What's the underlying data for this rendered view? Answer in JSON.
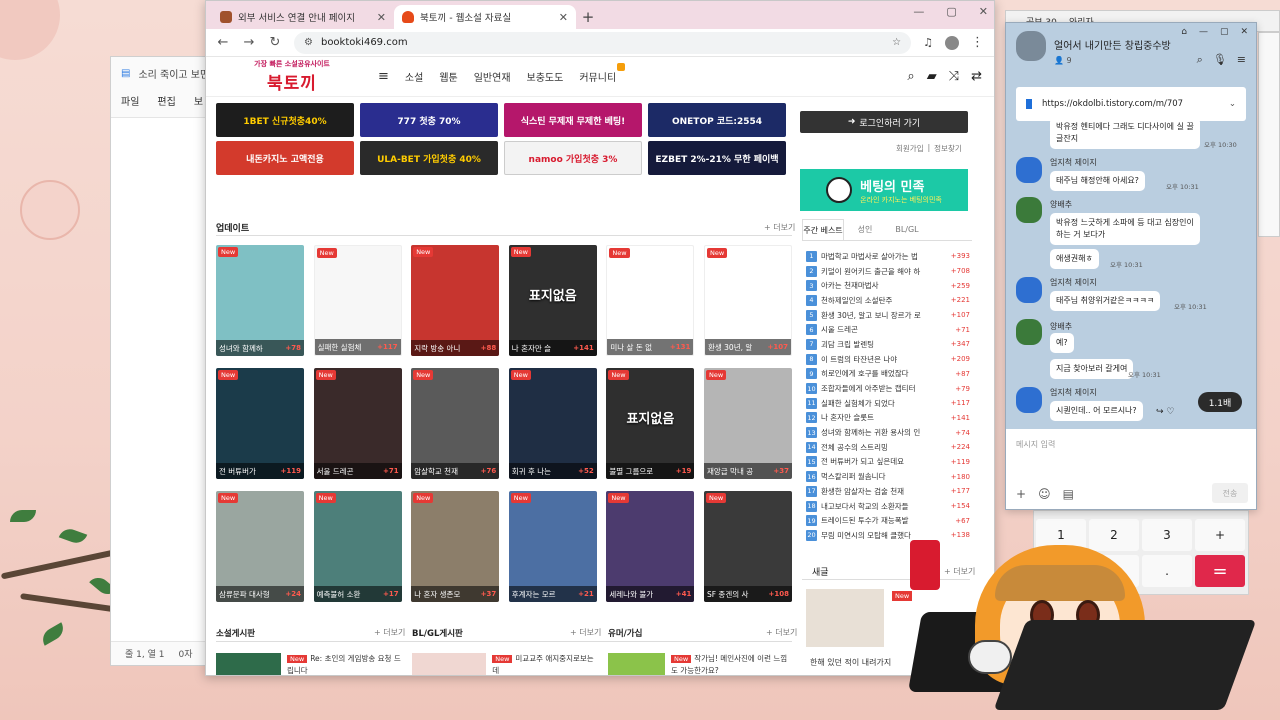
{
  "notepad": {
    "title": "소리 죽이고 보면",
    "menu": [
      "파일",
      "편집",
      "보"
    ],
    "status": [
      "줄 1, 열 1",
      "0자"
    ]
  },
  "browser": {
    "tabs": [
      {
        "title": "외부 서비스 연결 안내 페이지",
        "active": false
      },
      {
        "title": "북토끼 - 웹소설 자료실",
        "active": true
      }
    ],
    "url": "booktoki469.com"
  },
  "site": {
    "logo_tag": "가장 빠른 소설공유사이트",
    "logo_name": "북토끼",
    "nav": [
      "소설",
      "웹툰",
      "일반연재",
      "보충도도",
      "커뮤니티"
    ],
    "banners": [
      {
        "text": "1BET 신규첫충40%",
        "color": "#1d1d1d"
      },
      {
        "text": "777 첫충 70%",
        "color": "#2a2d8f"
      },
      {
        "text": "식스틴 무제재 무제한 베팅!",
        "color": "#b5176b"
      },
      {
        "text": "ONETOP 코드:2554",
        "color": "#1c2a66"
      },
      {
        "text": "내돈카지노 고액전용",
        "color": "#d33a2c"
      },
      {
        "text": "ULA-BET 가입첫충 40%",
        "color": "#2a2a2a"
      },
      {
        "text": "namoo 가입첫충 3%",
        "color": "#e7e7e7"
      },
      {
        "text": "EZBET 2%-21% 무한 페이백",
        "color": "#151a3b"
      }
    ],
    "update_title": "업데이트",
    "more": "+ 더보기",
    "new_label": "New",
    "cards": [
      {
        "title": "성녀와 함께하",
        "count": "+78",
        "bg": "#7fc0c4"
      },
      {
        "title": "실패한 실험체",
        "count": "+117",
        "bg": "#f7f7f7"
      },
      {
        "title": "지락 방송 아니",
        "count": "+88",
        "bg": "#c7352f"
      },
      {
        "title": "나 혼자만 슬",
        "count": "+141",
        "bg": "#2f2f2f",
        "wm": "표지없음"
      },
      {
        "title": "미나 살 돈 없",
        "count": "+131",
        "bg": "#ffffff"
      },
      {
        "title": "환생 30년, 알",
        "count": "+107",
        "bg": "#ffffff"
      },
      {
        "title": "전 버튜버가",
        "count": "+119",
        "bg": "#1b3b4a"
      },
      {
        "title": "서울 드레곤",
        "count": "+71",
        "bg": "#3a2a2a"
      },
      {
        "title": "암살학교 천재",
        "count": "+76",
        "bg": "#5a5a5a"
      },
      {
        "title": "회귀 후 나는",
        "count": "+52",
        "bg": "#1f2e44"
      },
      {
        "title": "불멸 그룹으로",
        "count": "+19",
        "bg": "#2f2f2f",
        "wm": "표지없음"
      },
      {
        "title": "재앙급 막내 공",
        "count": "+37",
        "bg": "#b5b5b5"
      },
      {
        "title": "삼류문파 대사형",
        "count": "+24",
        "bg": "#9aa6a0"
      },
      {
        "title": "예측불허 소환",
        "count": "+17",
        "bg": "#4d7f7a"
      },
      {
        "title": "나 혼자 생존모",
        "count": "+37",
        "bg": "#8c7e6a"
      },
      {
        "title": "후계자는 모르",
        "count": "+21",
        "bg": "#4c6fa3"
      },
      {
        "title": "세레나와 불가",
        "count": "+41",
        "bg": "#4c3b6e"
      },
      {
        "title": "SF 종겐의 사",
        "count": "+108",
        "bg": "#3a3a3a"
      }
    ],
    "sidebar": {
      "login": "로그인하러 가기",
      "links": [
        "회원가입",
        "정보찾기"
      ],
      "betting_title": "베팅의 민족",
      "betting_sub": "온라인 카지노는 베팅의민족",
      "rank_tabs": [
        "주간 베스트",
        "성인",
        "BL/GL"
      ],
      "ranks": [
        {
          "title": "마법학교 마법사로 살아가는 법",
          "count": "+393"
        },
        {
          "title": "키덜이 원어키드 출근을 해야 하",
          "count": "+708"
        },
        {
          "title": "아카는 천재마법사",
          "count": "+259"
        },
        {
          "title": "천하제일인의 소설탄주",
          "count": "+221"
        },
        {
          "title": "환생 30년, 알고 보니 장르가 로",
          "count": "+107"
        },
        {
          "title": "시울 드레곤",
          "count": "+71"
        },
        {
          "title": "괴담 크립 발렌팅",
          "count": "+347"
        },
        {
          "title": "이 트럼의 타잔년은 나야",
          "count": "+209"
        },
        {
          "title": "히로인에게 호구를 배었잖다",
          "count": "+87"
        },
        {
          "title": "조합자들에게 아주받는 캡티터",
          "count": "+79"
        },
        {
          "title": "실패한 실험체가 되었다",
          "count": "+117"
        },
        {
          "title": "나 혼자만 슬롯트",
          "count": "+141"
        },
        {
          "title": "성녀와 함께하는 귀환 용사의 인",
          "count": "+74"
        },
        {
          "title": "전체 공수의 스트리밍",
          "count": "+224"
        },
        {
          "title": "전 버튜버가 되고 싶은데요",
          "count": "+119"
        },
        {
          "title": "먹스칼리퍼 월솜니다",
          "count": "+180"
        },
        {
          "title": "환생한 암살자는 검술 천재",
          "count": "+177"
        },
        {
          "title": "내고보다서 학교의 소환자들",
          "count": "+154"
        },
        {
          "title": "트레이드된 투수가 재능폭발",
          "count": "+67"
        },
        {
          "title": "무림 미연시의 모탑해 클했다",
          "count": "+138"
        }
      ],
      "notice_title": "새글",
      "notice_text": "한해 있던 적이 내려가지"
    },
    "boards": [
      {
        "title": "소설게시판",
        "post": "Re: 초인의 게임방송 요청 드립니다",
        "thumb": "#2e6b4a"
      },
      {
        "title": "BL/GL게시판",
        "post": "미교교주 애지중지로보는데",
        "thumb": "#f0d7d2"
      },
      {
        "title": "유머/가십",
        "post": "작가님! 메인사진에 이런 느낌도 가능한가요?",
        "thumb": "#8bc34a"
      }
    ]
  },
  "desktop_behind": {
    "tabs": [
      "곰보 30",
      "와리자"
    ]
  },
  "calculator": {
    "keys": [
      "1",
      "2",
      "3",
      "+",
      "0",
      ".",
      "="
    ]
  },
  "chat": {
    "room": "얼어서 내기만든 창립중수방",
    "members": "9",
    "url": "https://okdolbi.tistory.com/m/707",
    "messages": [
      {
        "name": "",
        "text": "박유정 헨티에다 그래도 디다사이에 실 끌 글잔지",
        "time": "오후 10:30",
        "avatar": "#ffffff"
      },
      {
        "name": "엄지척 제이지",
        "text": "태주님 해정안해 아세요?",
        "time": "오후 10:31",
        "avatar": "#2e6fd1"
      },
      {
        "name": "양배추",
        "text": "박유정 느긋하게 소파에 등 대고 심장인이 하는 거 보다가",
        "time": "",
        "avatar": "#3b7a3a"
      },
      {
        "name": "",
        "text": "애생권해ㅎ",
        "time": "오후 10:31",
        "avatar": ""
      },
      {
        "name": "엄지척 제이지",
        "text": "태주님 취양위거같은ㅋㅋㅋㅋ",
        "time": "오후 10:31",
        "avatar": "#2e6fd1"
      },
      {
        "name": "양배추",
        "text": "예?",
        "time": "",
        "avatar": "#3b7a3a"
      },
      {
        "name": "",
        "text": "지금 찾아보러 갈게여",
        "time": "오후 10:31",
        "avatar": ""
      },
      {
        "name": "엄지척 제이지",
        "text": "시퀀인데.. 어 모르시나?",
        "time": "",
        "avatar": "#2e6fd1"
      }
    ],
    "input_placeholder": "메시지 입력",
    "send": "전송",
    "volume": "1.1배"
  }
}
